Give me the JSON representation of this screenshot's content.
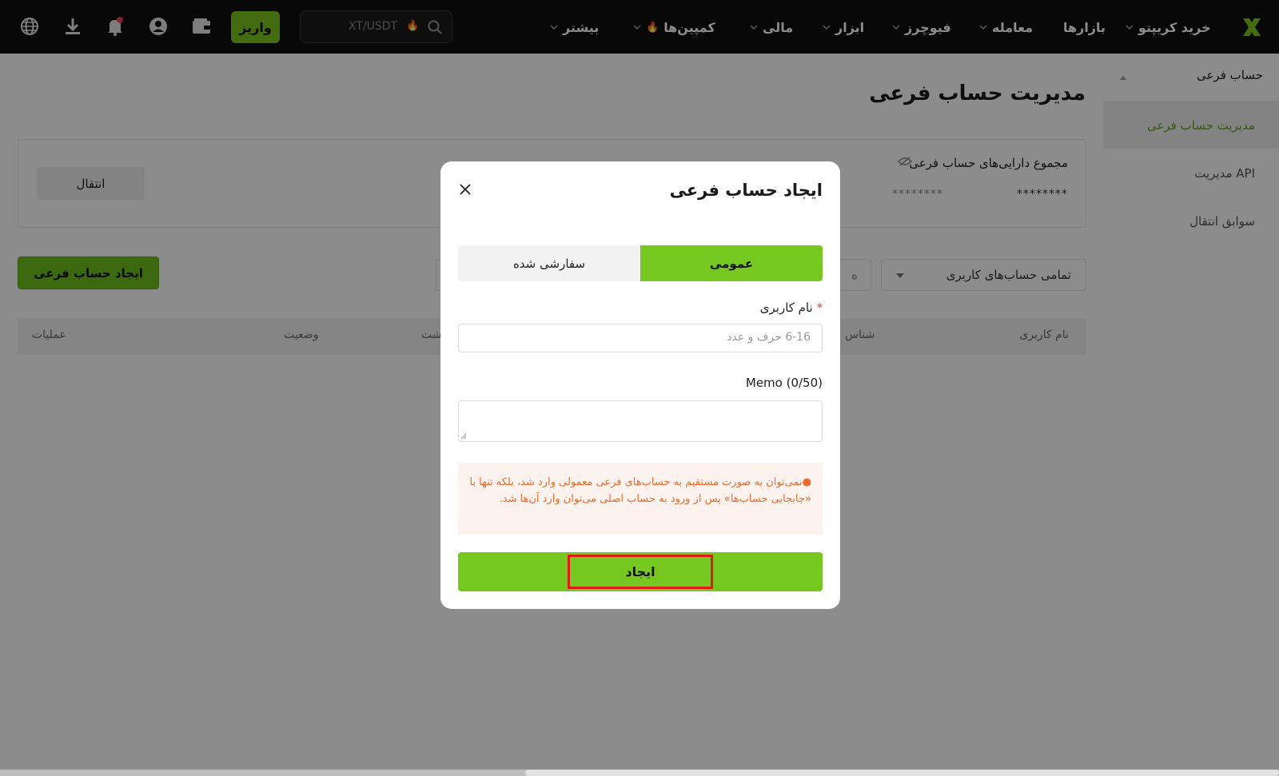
{
  "nav": {
    "buy_crypto": "خرید کریپتو",
    "markets": "بازارها",
    "trade": "معامله",
    "futures": "فیوچرز",
    "tools": "ابزار",
    "finance": "مالی",
    "campaigns": "کمپین‌ها",
    "more": "بیشتر",
    "search_placeholder": "XT/USDT",
    "deposit": "واریز",
    "brand_color": "#7ac51f"
  },
  "sidebar": {
    "section_title": "حساب فرعی",
    "items": [
      {
        "label": "مدیریت حساب فرعی",
        "active": true
      },
      {
        "label": "مدیریت API",
        "active": false
      },
      {
        "label": "سوابق انتقال",
        "active": false
      }
    ]
  },
  "main": {
    "title": "مدیریت حساب فرعی",
    "assets_label": "مجموع دارایی‌های حساب فرعی",
    "assets_value_1": "********",
    "assets_value_2": "********",
    "transfer_button": "انتقال",
    "create_subaccount_button": "ایجاد حساب فرعی",
    "filter_select": "تمامی حساب‌های کاربری",
    "filter_search_partial": "ه",
    "table_headers": {
      "username": "نام کاربری",
      "id": "شناس",
      "date": "شت",
      "status": "وضعیت",
      "actions": "عملیات"
    }
  },
  "modal": {
    "title": "ایجاد حساب فرعی",
    "tabs": [
      "عمومی",
      "سفارشی شده"
    ],
    "active_tab": "عمومی",
    "username_label": "نام کاربری",
    "username_placeholder": "6-16 حرف و عدد",
    "memo_label": "Memo (0/50)",
    "memo_value": "",
    "warning": "●نمی‌توان به صورت مستقیم به حساب‌های فرعی معمولی وارد شد، بلکه تنها با «جابجایی حساب‌ها» پس از ورود به حساب اصلی می‌توان وارد آن‌ها شد.",
    "submit_button": "ایجاد"
  }
}
